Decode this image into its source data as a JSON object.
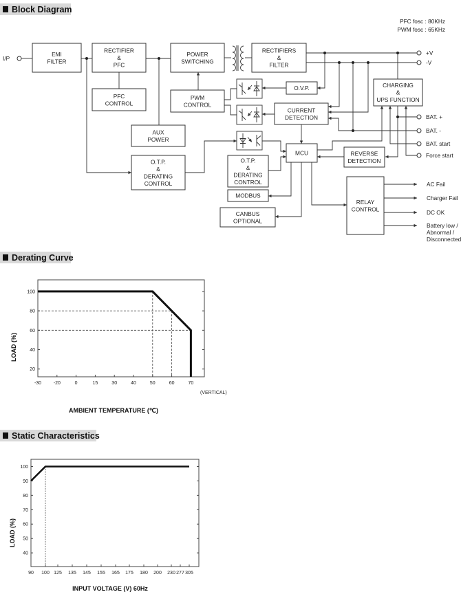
{
  "block_diagram": {
    "header": "Block Diagram",
    "freq": [
      "PFC fosc : 80KHz",
      "PWM fosc : 65KHz"
    ],
    "input_label": "I/P",
    "blocks": {
      "emi_filter": [
        "EMI",
        "FILTER"
      ],
      "rectifier_pfc": [
        "RECTIFIER",
        "&",
        "PFC"
      ],
      "pfc_control": [
        "PFC",
        "CONTROL"
      ],
      "power_switching": [
        "POWER",
        "SWITCHING"
      ],
      "pwm_control": [
        "PWM",
        "CONTROL"
      ],
      "aux_power": [
        "AUX",
        "POWER"
      ],
      "otp_derating_1": [
        "O.T.P.",
        "&",
        "DERATING",
        "CONTROL"
      ],
      "rectifiers_filter": [
        "RECTIFIERS",
        "&",
        "FILTER"
      ],
      "ovp": [
        "O.V.P."
      ],
      "current_detection": [
        "CURRENT",
        "DETECTION"
      ],
      "charging_ups": [
        "CHARGING",
        "&",
        "UPS FUNCTION"
      ],
      "mcu": [
        "MCU"
      ],
      "reverse_detection": [
        "REVERSE",
        "DETECTION"
      ],
      "otp_derating_2": [
        "O.T.P.",
        "&",
        "DERATING",
        "CONTROL"
      ],
      "modbus": [
        "MODBUS"
      ],
      "canbus": [
        "CANBUS",
        "OPTIONAL"
      ],
      "relay_control": [
        "RELAY",
        "CONTROL"
      ]
    },
    "terminals": [
      "+V",
      "-V",
      "BAT. +",
      "BAT. -",
      "BAT. start",
      "Force start"
    ],
    "relay_outputs": [
      "AC Fail",
      "Charger Fail",
      "DC OK",
      [
        "Battery low /",
        "Abnormal /",
        "Disconnected"
      ]
    ]
  },
  "chart_data": [
    {
      "header": "Derating Curve",
      "type": "line",
      "xlabel": "AMBIENT TEMPERATURE (℃)",
      "ylabel": "LOAD (%)",
      "x_note": "(VERTICAL)",
      "x_ticks": [
        "-30",
        "-20",
        "0",
        "15",
        "30",
        "40",
        "50",
        "60",
        "70"
      ],
      "y_ticks": [
        "20",
        "40",
        "60",
        "80",
        "100"
      ],
      "ylim": [
        12,
        112
      ],
      "series": [
        {
          "x": [
            -30,
            50,
            60,
            70,
            70
          ],
          "y": [
            100,
            100,
            80,
            60,
            0
          ]
        }
      ],
      "reference_lines": {
        "horizontal": [
          80,
          60
        ],
        "vertical": [
          50,
          60
        ]
      },
      "grid": false
    },
    {
      "header": "Static Characteristics",
      "type": "line",
      "xlabel": "INPUT VOLTAGE (V) 60Hz",
      "ylabel": "LOAD (%)",
      "x_ticks": [
        "90",
        "100",
        "125",
        "135",
        "145",
        "155",
        "165",
        "175",
        "180",
        "200",
        "230",
        "277",
        "305"
      ],
      "y_ticks": [
        "40",
        "50",
        "60",
        "70",
        "80",
        "90",
        "100"
      ],
      "ylim": [
        30.5,
        105
      ],
      "series": [
        {
          "x": [
            90,
            100,
            305
          ],
          "y": [
            90,
            100,
            100
          ]
        }
      ],
      "reference_lines": {
        "vertical": [
          100
        ]
      },
      "grid": false
    }
  ]
}
